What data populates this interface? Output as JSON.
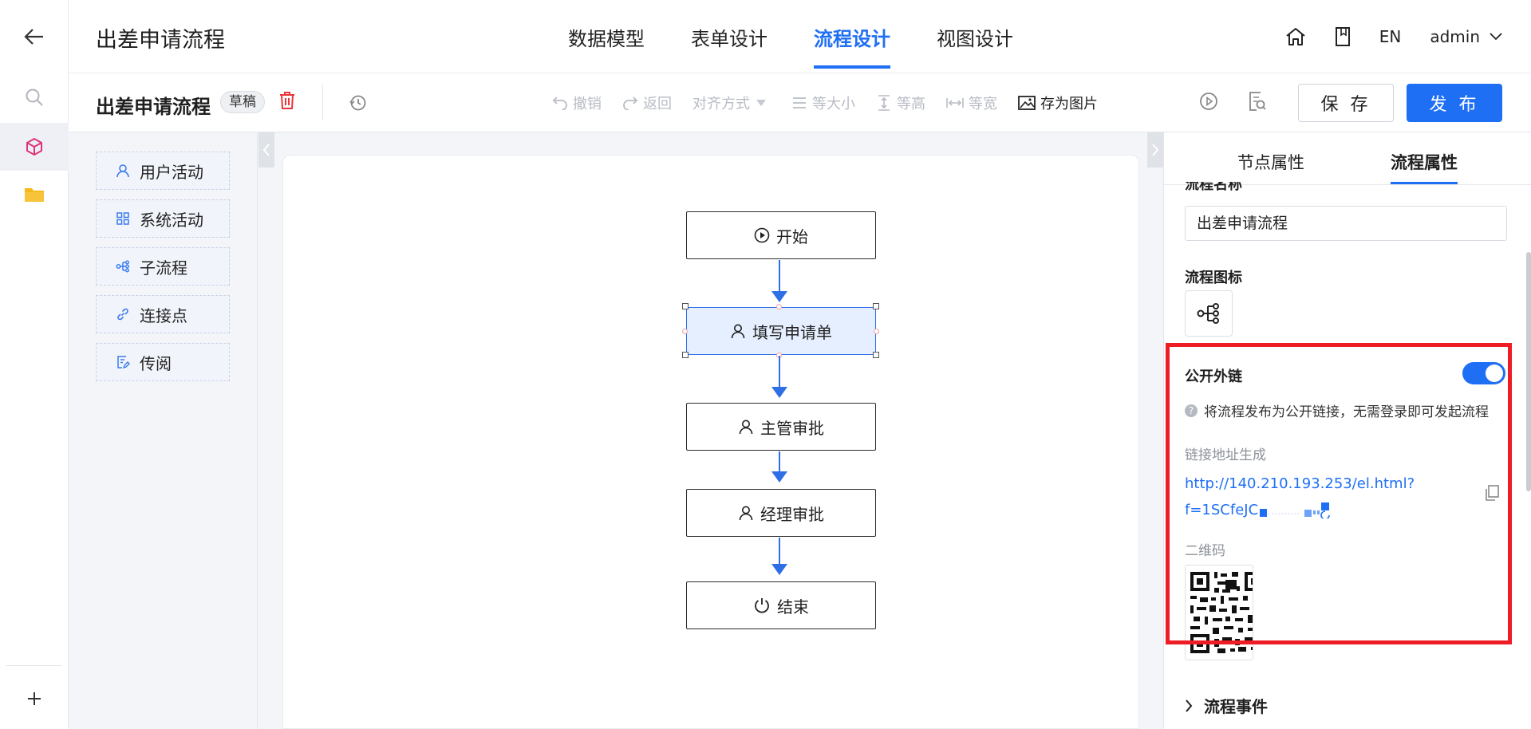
{
  "header": {
    "app_title": "出差申请流程",
    "tabs": [
      {
        "label": "数据模型"
      },
      {
        "label": "表单设计"
      },
      {
        "label": "流程设计"
      },
      {
        "label": "视图设计"
      }
    ],
    "active_tab": "流程设计",
    "lang": "EN",
    "user": "admin"
  },
  "toolbar": {
    "title": "出差申请流程",
    "status_badge": "草稿",
    "undo": "撤销",
    "redo": "返回",
    "align": "对齐方式",
    "same_size": "等大小",
    "same_height": "等高",
    "same_width": "等宽",
    "save_image": "存为图片",
    "save": "保 存",
    "publish": "发 布"
  },
  "palette": {
    "items": [
      {
        "label": "用户活动",
        "icon": "user-icon"
      },
      {
        "label": "系统活动",
        "icon": "grid-icon"
      },
      {
        "label": "子流程",
        "icon": "subflow-icon"
      },
      {
        "label": "连接点",
        "icon": "link-icon"
      },
      {
        "label": "传阅",
        "icon": "circulate-icon"
      }
    ]
  },
  "flow": {
    "nodes": [
      {
        "label": "开始",
        "icon": "play-icon"
      },
      {
        "label": "填写申请单",
        "icon": "user-icon",
        "selected": true
      },
      {
        "label": "主管审批",
        "icon": "user-icon"
      },
      {
        "label": "经理审批",
        "icon": "user-icon"
      },
      {
        "label": "结束",
        "icon": "power-icon"
      }
    ]
  },
  "panel": {
    "tabs": [
      {
        "label": "节点属性"
      },
      {
        "label": "流程属性"
      }
    ],
    "active_tab": "流程属性",
    "name_label": "流程名称",
    "name_value": "出差申请流程",
    "icon_label": "流程图标",
    "public_link_label": "公开外链",
    "public_link_enabled": true,
    "public_link_hint": "将流程发布为公开链接，无需登录即可发起流程",
    "link_gen_label": "链接地址生成",
    "link_line1": "http://140.210.193.253/el.html?",
    "link_line2": "f=1SCfeJC",
    "qr_label": "二维码",
    "events_label": "流程事件"
  },
  "colors": {
    "accent": "#1f6ff5",
    "highlight_box": "#ee1c25",
    "active_rail_icon": "#e0337a",
    "folder_icon": "#f5b91a"
  }
}
